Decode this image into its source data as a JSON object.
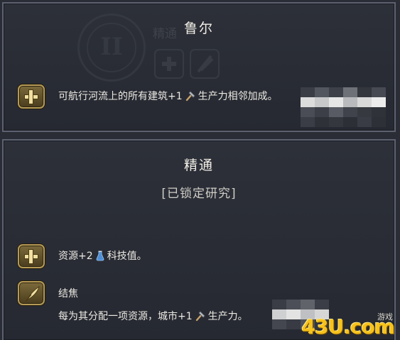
{
  "panel1": {
    "bg_roman": "II",
    "bg_label": "精通",
    "title": "鲁尔",
    "ability": {
      "text_before": "可航行河流上的所有建筑+1",
      "text_after": "生产力相邻加成。",
      "icon": "plus-icon",
      "inline_icon": "hammer-icon"
    }
  },
  "panel2": {
    "title": "精通",
    "subtitle": "[已锁定研究]",
    "ability1": {
      "text_before": "资源+2",
      "text_after": "科技值。",
      "icon": "plus-icon",
      "inline_icon": "science-flask-icon"
    },
    "ability2": {
      "heading": "结焦",
      "text_before": "每为其分配一项资源，城市+1",
      "text_after": "生产力。",
      "icon": "quill-icon",
      "inline_icon": "hammer-icon"
    }
  },
  "watermark": {
    "main": "43U.com",
    "small": "游戏"
  },
  "colors": {
    "panel_bg": "#2a2d35",
    "border": "#5d6270",
    "icon_gold": "#b59a55",
    "text": "#ebe9e2"
  }
}
